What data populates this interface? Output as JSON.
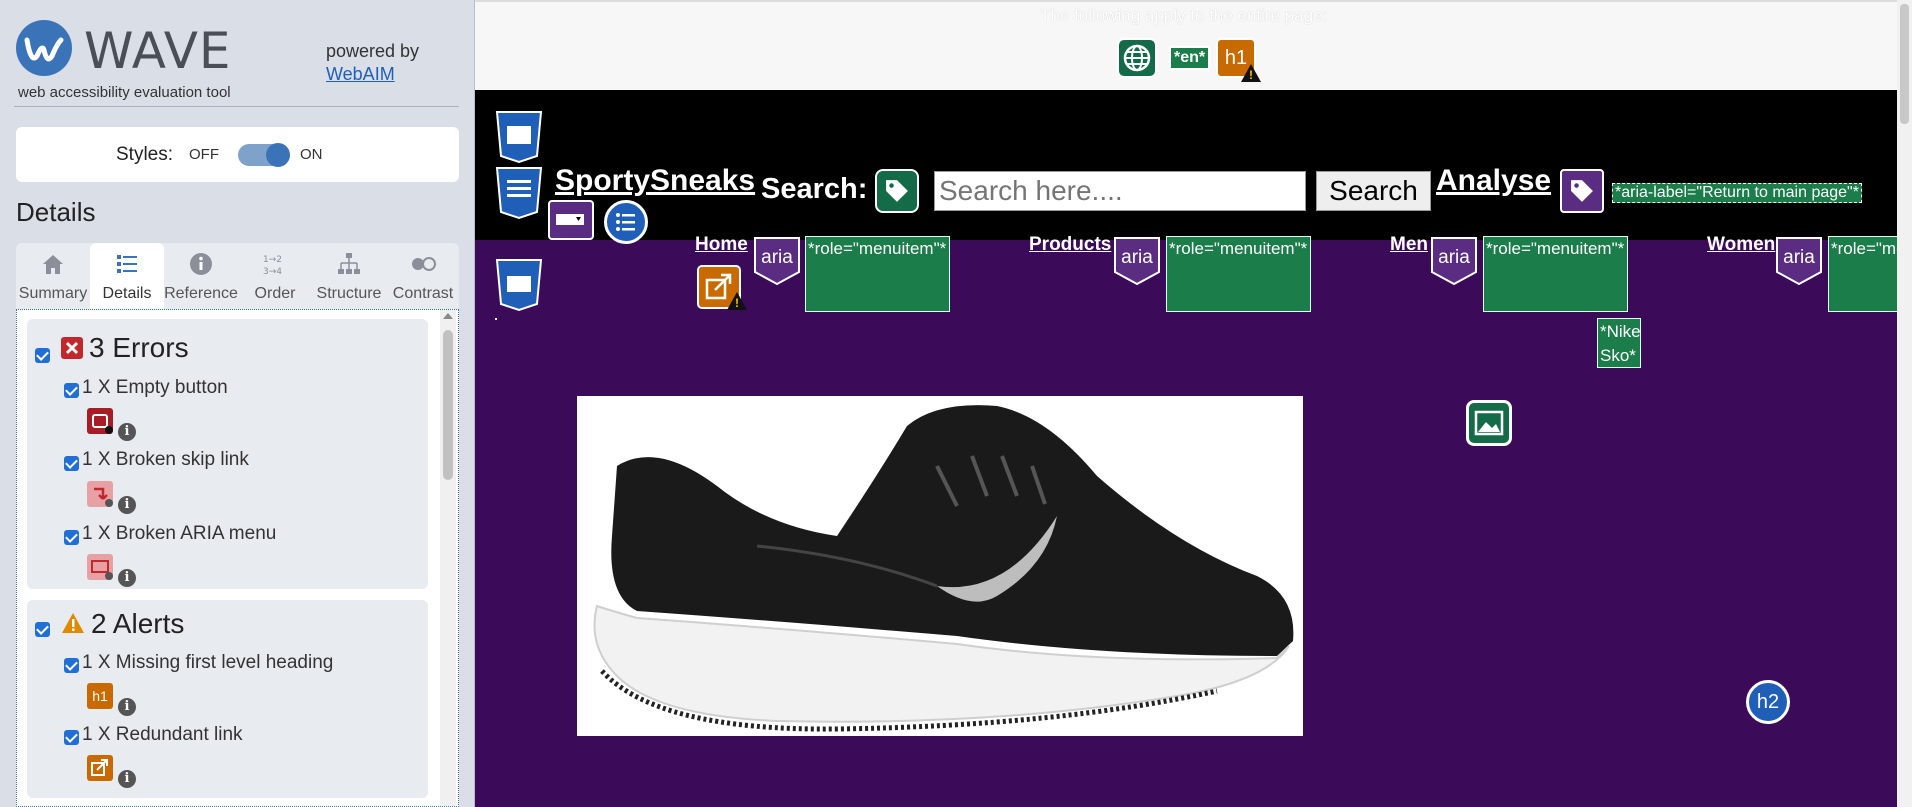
{
  "sidebar": {
    "title": "WAVE",
    "subtitle": "web accessibility evaluation tool",
    "powered_by": "powered by",
    "webaim_link": "WebAIM",
    "styles": {
      "label": "Styles:",
      "off": "OFF",
      "on": "ON",
      "state": "on"
    },
    "details_heading": "Details",
    "tabs": [
      {
        "label": "Summary",
        "icon": "home-icon"
      },
      {
        "label": "Details",
        "icon": "list-icon",
        "active": true
      },
      {
        "label": "Reference",
        "icon": "info-icon"
      },
      {
        "label": "Order",
        "icon": "order-icon"
      },
      {
        "label": "Structure",
        "icon": "structure-icon"
      },
      {
        "label": "Contrast",
        "icon": "contrast-icon"
      }
    ],
    "errors": {
      "heading": "3 Errors",
      "items": [
        {
          "label": "1 X Empty button"
        },
        {
          "label": "1 X Broken skip link"
        },
        {
          "label": "1 X Broken ARIA menu"
        }
      ]
    },
    "alerts": {
      "heading": "2 Alerts",
      "items": [
        {
          "label": "1 X Missing first level heading",
          "icon_text": "h1"
        },
        {
          "label": "1 X Redundant link"
        }
      ]
    },
    "info_glyph": "i"
  },
  "preview": {
    "apply_text": "The following apply to the entire page:",
    "lang_badge": "*en*",
    "h1_badge": "h1",
    "h2_badge": "h2",
    "brand": "SportySneaks",
    "search_label": "Search:",
    "search_placeholder": "Search here....",
    "search_button": "Search",
    "analyse": "Analyse",
    "aria_label_note": "*aria-label=\"Return to main page\"*",
    "nav": [
      {
        "label": "Home",
        "aria": "aria",
        "role": "*role=\"menuitem\"*"
      },
      {
        "label": "Products",
        "aria": "aria",
        "role": "*role=\"menuitem\"*"
      },
      {
        "label": "Men",
        "aria": "aria",
        "role": "*role=\"menuitem\"*"
      },
      {
        "label": "Women",
        "aria": "aria",
        "role": "*role=\"menuitem\"*"
      }
    ],
    "nike_note": "*Nike Sko*",
    "dot_text": "."
  }
}
